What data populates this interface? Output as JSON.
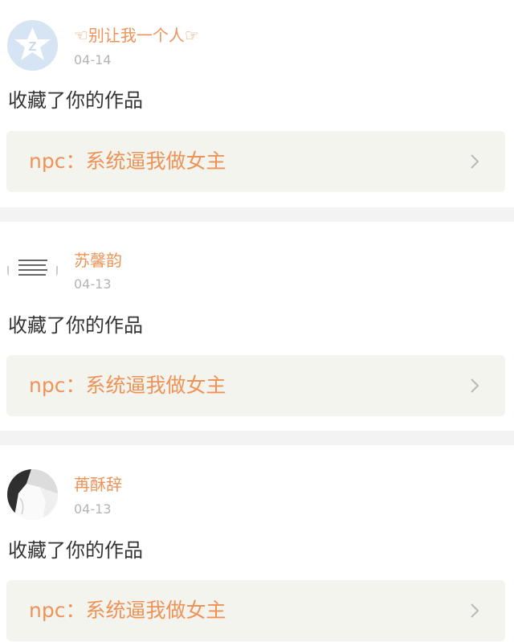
{
  "items": [
    {
      "username": "☜别让我一个人☞",
      "date": "04-14",
      "action": "收藏了你的作品",
      "work_title": "npc：系统逼我做女主",
      "avatar": "default-qq-avatar"
    },
    {
      "username": "苏馨韵",
      "date": "04-13",
      "action": "收藏了你的作品",
      "work_title": "npc：系统逼我做女主",
      "avatar": "text-image-avatar"
    },
    {
      "username": "苒酥辞",
      "date": "04-13",
      "action": "收藏了你的作品",
      "work_title": "npc：系统逼我做女主",
      "avatar": "photo-avatar"
    }
  ],
  "colors": {
    "accent": "#ee9358",
    "date": "#b4b4b4",
    "text": "#333333",
    "work_bg": "#f4f4ef",
    "divider": "#f3f3f3"
  }
}
